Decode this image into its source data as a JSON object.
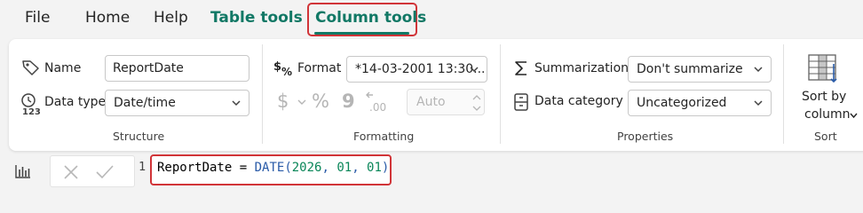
{
  "menu": {
    "items": [
      "File",
      "Home",
      "Help",
      "Table tools",
      "Column tools"
    ],
    "active": "Column tools"
  },
  "structure": {
    "name_label": "Name",
    "name_value": "ReportDate",
    "datatype_label": "Data type",
    "datatype_value": "Date/time",
    "group_label": "Structure"
  },
  "formatting": {
    "format_label": "Format",
    "format_value": "*14-03-2001 13:30...",
    "currency_symbol": "$",
    "percent_symbol": "%",
    "comma_symbol": "9",
    "decimal_symbol": ".00",
    "auto_value": "Auto",
    "group_label": "Formatting"
  },
  "properties": {
    "summarization_label": "Summarization",
    "summarization_value": "Don't summarize",
    "category_label": "Data category",
    "category_value": "Uncategorized",
    "group_label": "Properties"
  },
  "sort": {
    "button_line1": "Sort by",
    "button_line2": "column",
    "group_label": "Sort"
  },
  "formula_bar": {
    "line_number": "1",
    "tokens": {
      "column": "ReportDate",
      "equals": " = ",
      "func": "DATE",
      "open": "(",
      "year": "2026",
      "sep1": ", ",
      "month": "01",
      "sep2": ", ",
      "day": "01",
      "close": ")"
    }
  },
  "colors": {
    "accent_green": "#117865",
    "highlight_red": "#d13438"
  }
}
